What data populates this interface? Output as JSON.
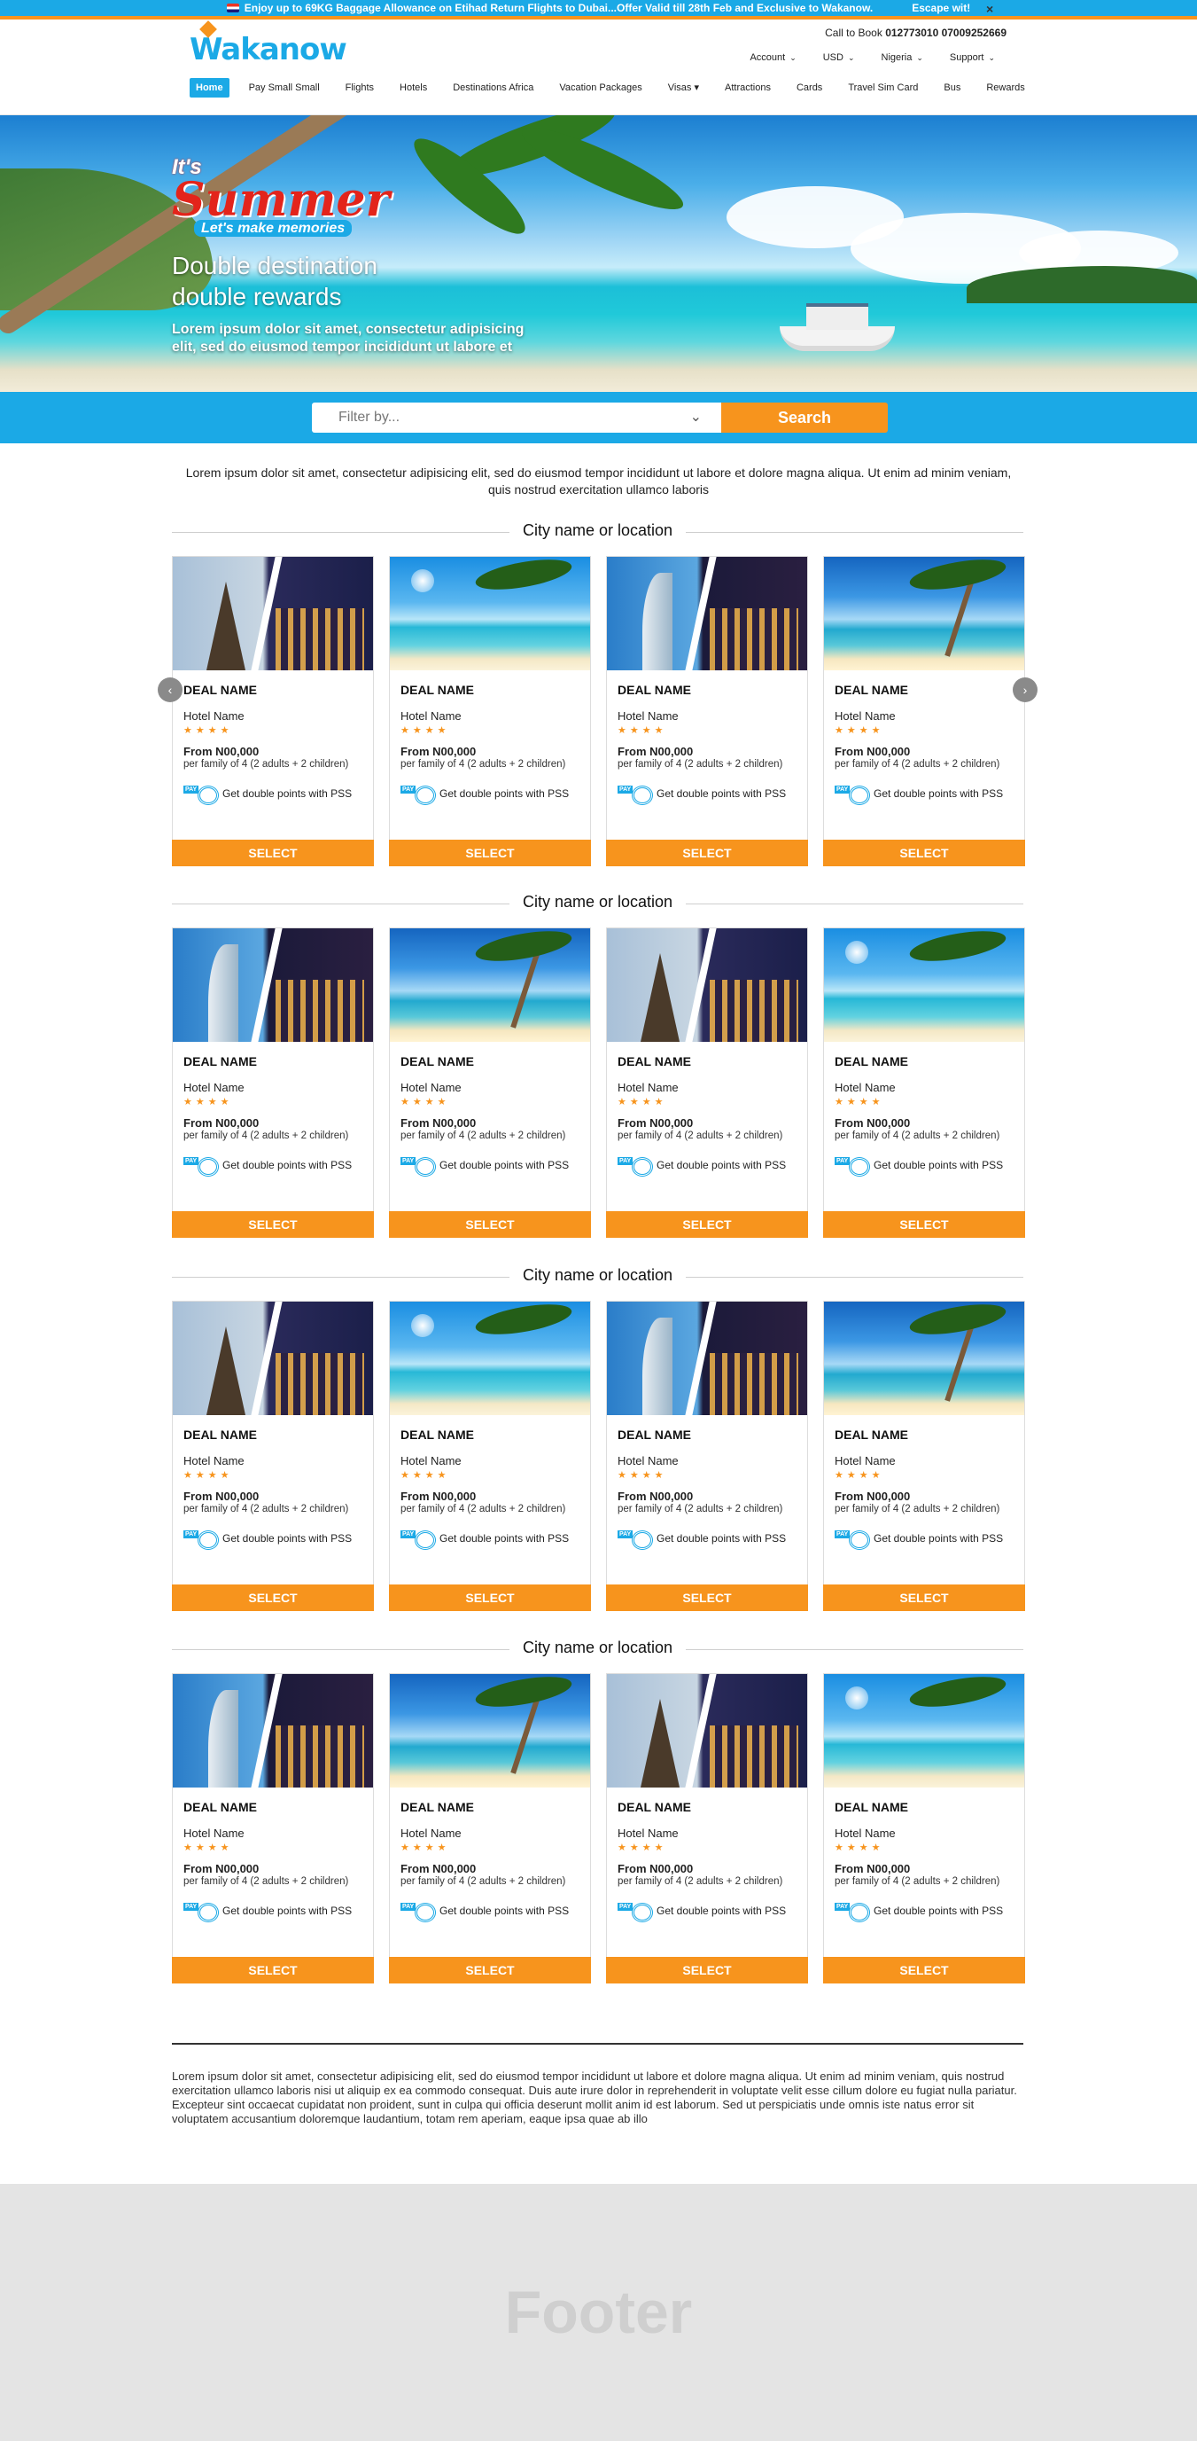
{
  "promo": {
    "text": "Enjoy up to 69KG Baggage Allowance on Etihad Return Flights to Dubai...Offer Valid till 28th Feb and Exclusive to Wakanow.",
    "escape": "Escape wit!",
    "close": "×"
  },
  "header": {
    "logo": "Wakanow",
    "callbook_label": "Call to Book",
    "callbook_numbers": "012773010 07009252669",
    "toplinks": [
      "Account",
      "USD",
      "Nigeria",
      "Support"
    ],
    "nav": [
      "Home",
      "Pay Small Small",
      "Flights",
      "Hotels",
      "Destinations Africa",
      "Vacation Packages",
      "Visas",
      "Attractions",
      "Cards",
      "Travel Sim Card",
      "Bus",
      "Rewards"
    ]
  },
  "hero": {
    "its": "It's",
    "summer": "Summer",
    "memories": "Let's make memories",
    "title_line1": "Double destination",
    "title_line2": "double rewards",
    "subtitle": "Lorem ipsum dolor sit amet, consectetur adipisicing elit, sed do eiusmod tempor incididunt ut labore et"
  },
  "search": {
    "placeholder": "Filter by...",
    "button": "Search"
  },
  "intro": "Lorem ipsum dolor sit amet, consectetur adipisicing elit, sed do eiusmod tempor incididunt ut labore et dolore magna aliqua. Ut enim ad minim veniam, quis nostrud exercitation ullamco laboris",
  "card_common": {
    "deal": "DEAL NAME",
    "hotel": "Hotel Name",
    "stars": "★★★★",
    "price": "From N00,000",
    "per": "per family of 4 (2 adults + 2 children)",
    "pss": "Get double points with PSS",
    "select": "SELECT"
  },
  "sections": [
    {
      "title": "City name or location",
      "images": [
        "paris",
        "beach",
        "dubai",
        "palm"
      ]
    },
    {
      "title": "City name or location",
      "images": [
        "dubai",
        "palm",
        "paris",
        "beach"
      ]
    },
    {
      "title": "City name or location",
      "images": [
        "paris",
        "beach",
        "dubai",
        "palm"
      ]
    },
    {
      "title": "City name or location",
      "images": [
        "dubai",
        "palm",
        "paris",
        "beach"
      ]
    }
  ],
  "footer_text": "Lorem ipsum dolor sit amet, consectetur adipisicing elit, sed do eiusmod tempor incididunt ut labore et dolore magna aliqua. Ut enim ad minim veniam, quis nostrud exercitation ullamco laboris nisi ut aliquip ex ea commodo consequat. Duis aute irure dolor in reprehenderit in voluptate velit esse cillum dolore eu fugiat nulla pariatur. Excepteur sint occaecat cupidatat non proident, sunt in culpa qui officia deserunt mollit anim id est laborum. Sed ut perspiciatis unde omnis iste natus error sit voluptatem accusantium doloremque laudantium, totam rem aperiam, eaque ipsa quae ab illo",
  "footer_label": "Footer",
  "colors": {
    "accent": "#1ba9e6",
    "orange": "#f7941d"
  }
}
